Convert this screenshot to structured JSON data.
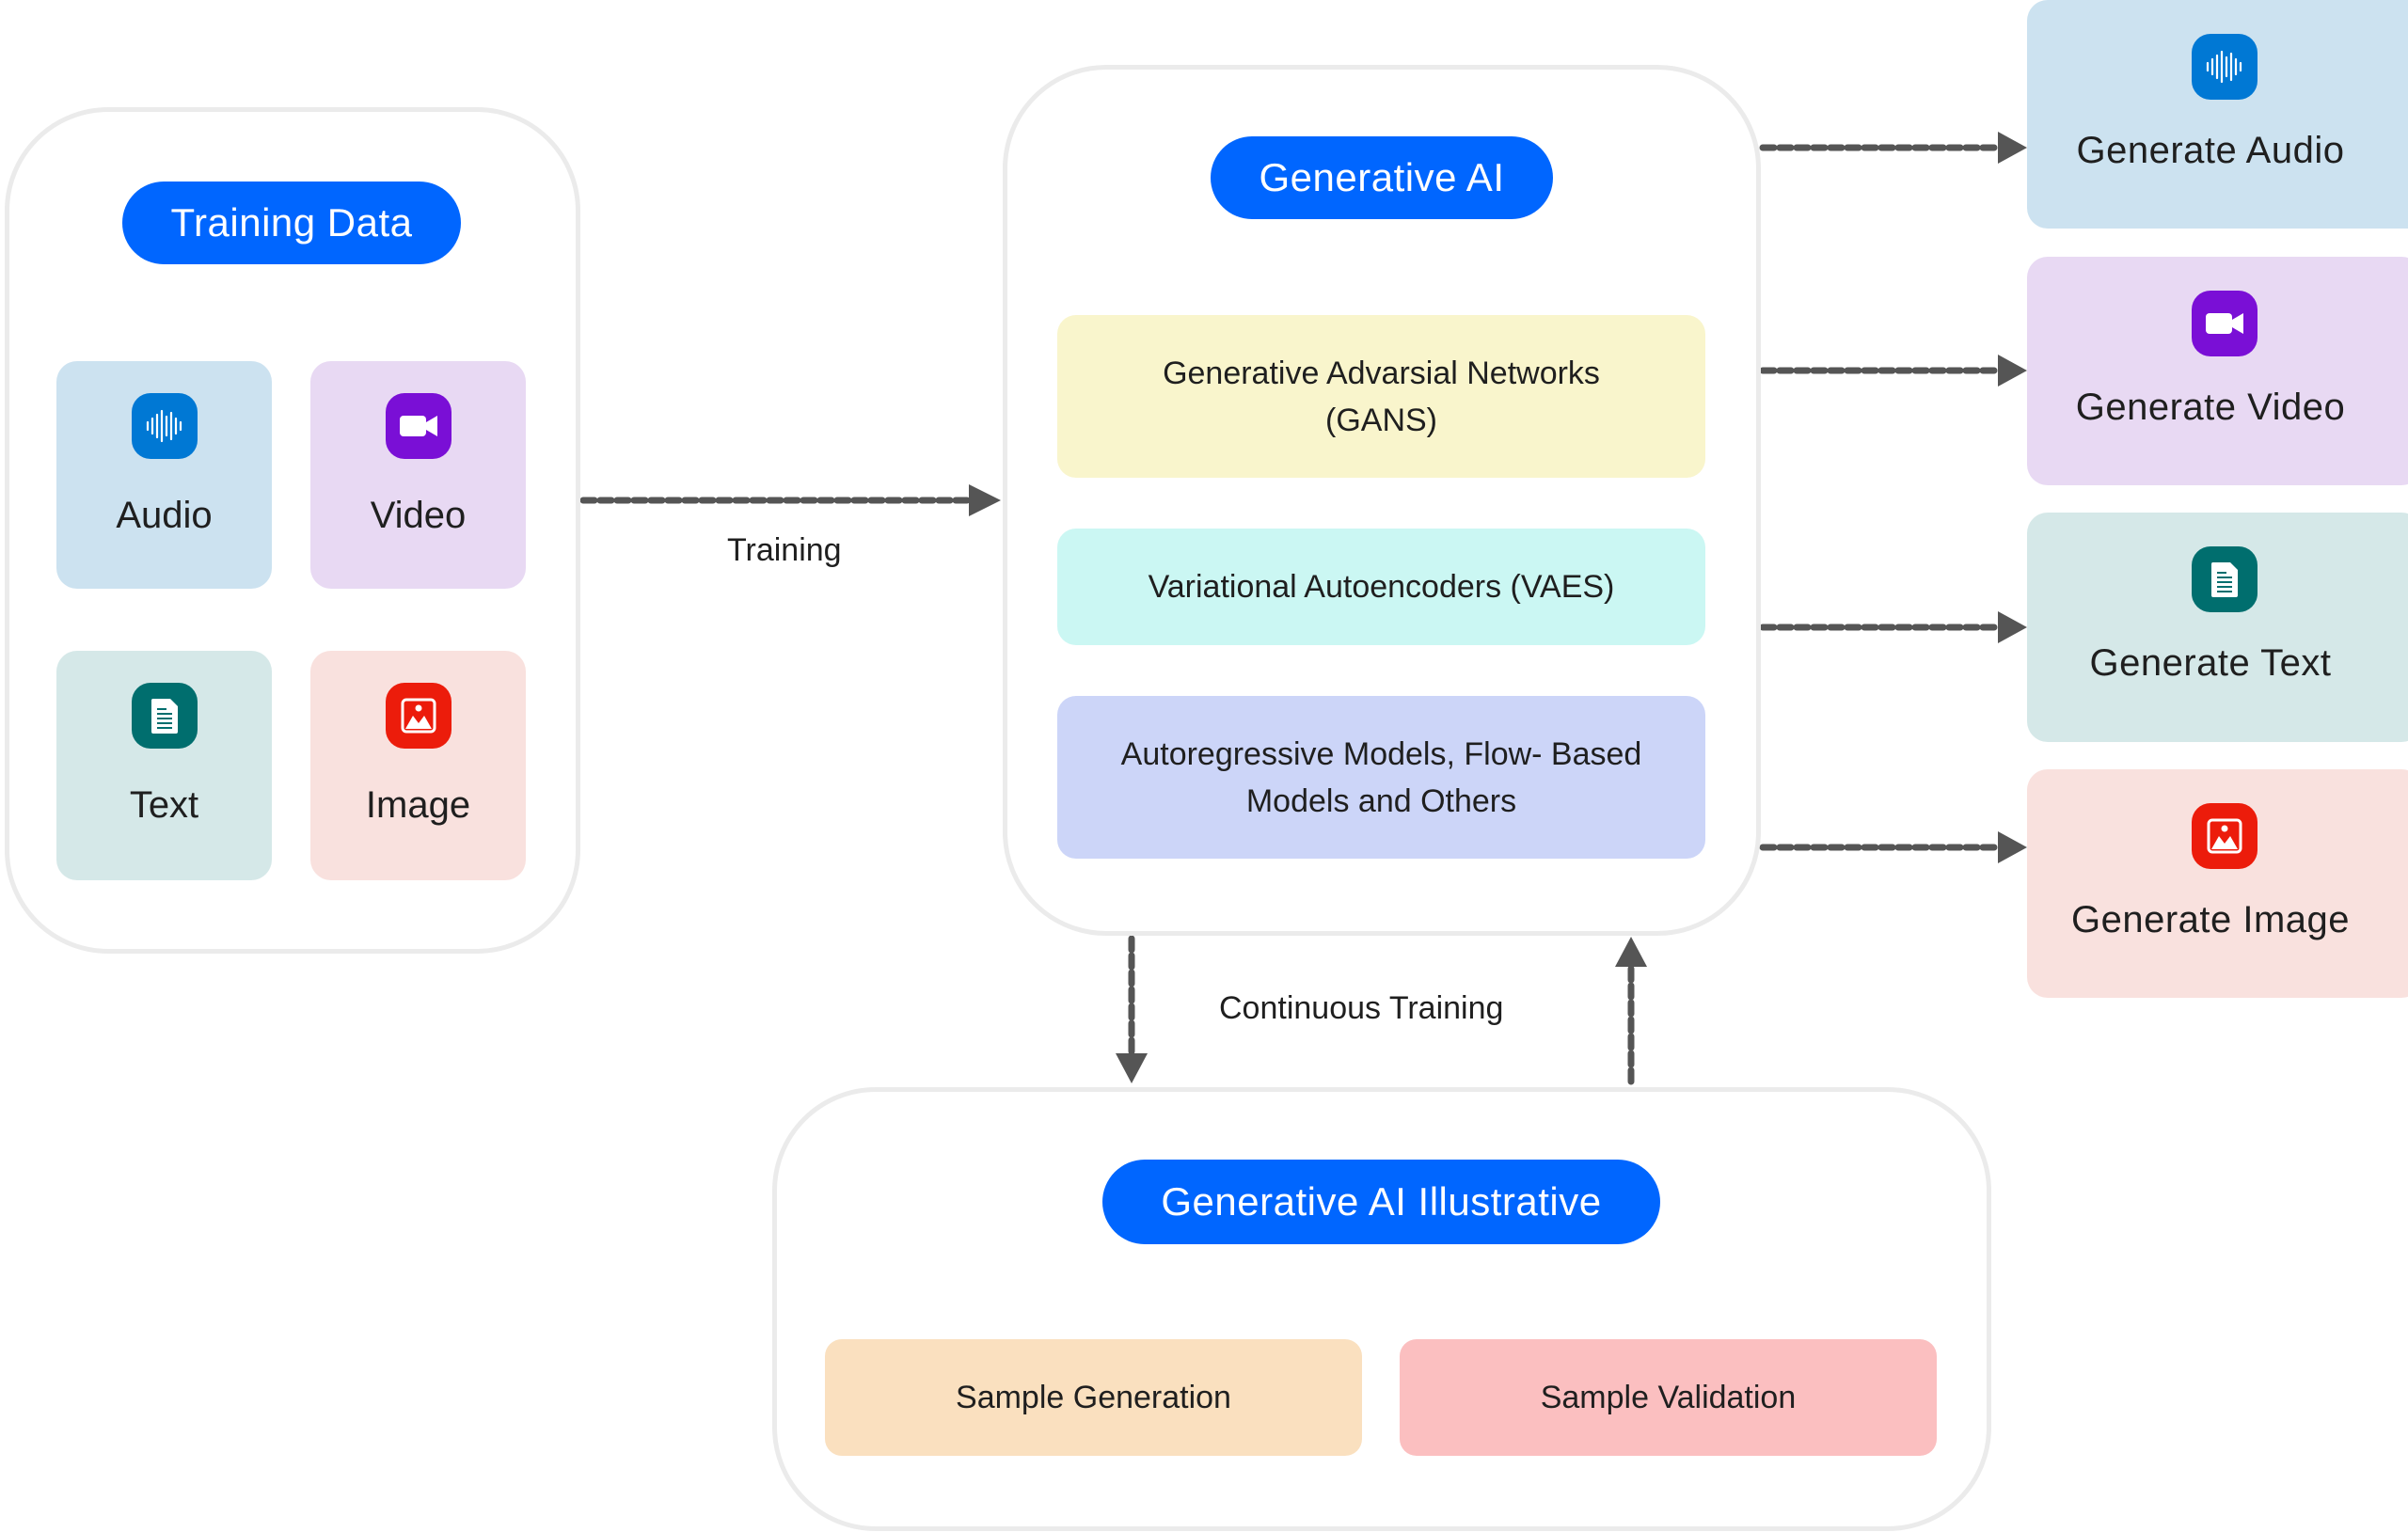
{
  "training_data": {
    "title": "Training Data",
    "items": [
      {
        "label": "Audio",
        "icon": "audio-waveform-icon",
        "bg": "#cce2f0",
        "icon_bg": "#0078d4"
      },
      {
        "label": "Video",
        "icon": "video-camera-icon",
        "bg": "#e8d9f3",
        "icon_bg": "#7a0fd6"
      },
      {
        "label": "Text",
        "icon": "document-icon",
        "bg": "#d5e8e8",
        "icon_bg": "#006e6e"
      },
      {
        "label": "Image",
        "icon": "image-icon",
        "bg": "#f9e1de",
        "icon_bg": "#ec1c0b"
      }
    ]
  },
  "edges": {
    "training": "Training",
    "continuous_training": "Continuous Training"
  },
  "generative_ai": {
    "title": "Generative AI",
    "models": [
      {
        "label": "Generative Advarsial Networks (GANS)",
        "bg": "#f9f5cc"
      },
      {
        "label": "Variational Autoencoders (VAES)",
        "bg": "#cbf7f3"
      },
      {
        "label": "Autoregressive Models, Flow- Based Models and Others",
        "bg": "#ccd5f8"
      }
    ]
  },
  "outputs": [
    {
      "label": "Generate Audio",
      "icon": "audio-waveform-icon",
      "bg": "#cce2f0",
      "icon_bg": "#0078d4"
    },
    {
      "label": "Generate Video",
      "icon": "video-camera-icon",
      "bg": "#e8d9f3",
      "icon_bg": "#7a0fd6"
    },
    {
      "label": "Generate Text",
      "icon": "document-icon",
      "bg": "#d5e8e8",
      "icon_bg": "#006e6e"
    },
    {
      "label": "Generate Image",
      "icon": "image-icon",
      "bg": "#f9e1de",
      "icon_bg": "#ec1c0b"
    }
  ],
  "illustrative": {
    "title": "Generative AI Illustrative",
    "steps": [
      {
        "label": "Sample Generation",
        "bg": "#fae0bf"
      },
      {
        "label": "Sample Validation",
        "bg": "#fbbfc0"
      }
    ]
  },
  "colors": {
    "accent": "#0066ff",
    "arrow": "#555555",
    "container_border": "#ebebeb"
  }
}
